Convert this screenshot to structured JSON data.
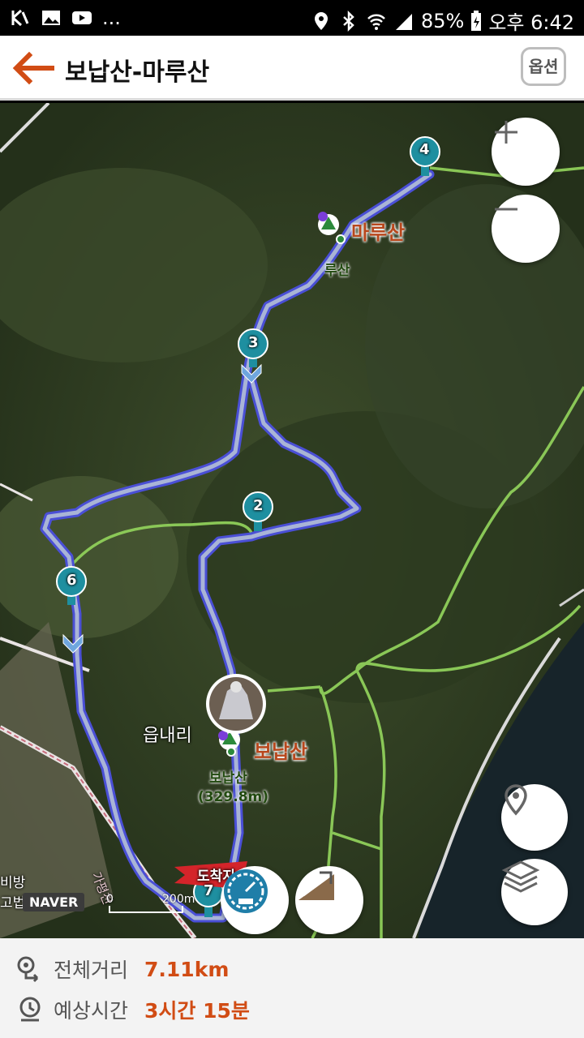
{
  "status_bar": {
    "left_icons": [
      "k-icon",
      "image-icon",
      "youtube-icon"
    ],
    "more": "...",
    "battery": "85%",
    "time": "오후 6:42"
  },
  "app_bar": {
    "title": "보납산-마루산",
    "option_label": "옵션"
  },
  "map": {
    "waypoints": [
      "2",
      "3",
      "4",
      "6",
      "7"
    ],
    "labels": {
      "marusan": "마루산",
      "marusan_small": "루산",
      "bonapsan": "보납산",
      "bonapsan_small": "보납산",
      "bonapsan_alt": "(329.8m)",
      "village": "읍내리",
      "arrival": "도착지",
      "road": "가평천",
      "left_text1": "비방",
      "left_text2": "고법원"
    },
    "scale": {
      "zero": "0",
      "distance": "200m"
    },
    "attribution": "NAVER",
    "controls": {
      "zoom_in": "+",
      "zoom_out": "−"
    }
  },
  "summary": {
    "distance_label": "전체거리",
    "distance_value": "7.11km",
    "time_label": "예상시간",
    "time_value": "3시간 15분"
  },
  "colors": {
    "accent": "#d14c14",
    "route": "#4a4fd6",
    "marker": "#1e8fa0"
  }
}
